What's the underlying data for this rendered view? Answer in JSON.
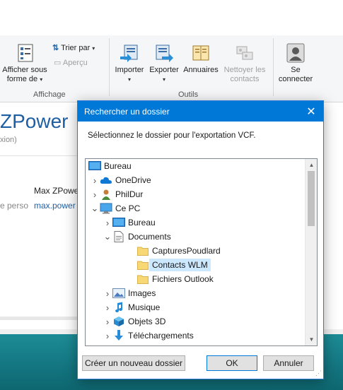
{
  "ribbon": {
    "affichage_group": "Affichage",
    "outils_group": "Outils",
    "afficher_sous_forme": "Afficher sous forme de",
    "afficher_line1": "Afficher sous",
    "afficher_line2": "forme de",
    "trier_par": "Trier par",
    "apercu": "Aperçu",
    "importer": "Importer",
    "exporter": "Exporter",
    "annuaires": "Annuaires",
    "nettoyer_line1": "Nettoyer les",
    "nettoyer_line2": "contacts",
    "se_line1": "Se",
    "se_line2": "connecter"
  },
  "background": {
    "title": "ZPower",
    "subtitle": "xion)",
    "contact_name": "Max ZPowe",
    "email_label": "e perso",
    "email_value": "max.power"
  },
  "dialog": {
    "title": "Rechercher un dossier",
    "message": "Sélectionnez le dossier pour l'exportation VCF.",
    "new_folder_button": "Créer un nouveau dossier",
    "ok_button": "OK",
    "cancel_button": "Annuler",
    "tree": [
      {
        "label": "Bureau",
        "icon": "desktop-icon",
        "arrow": "",
        "level": 0
      },
      {
        "label": "OneDrive",
        "icon": "onedrive-cloud-icon",
        "arrow": "›",
        "level": 1
      },
      {
        "label": "PhilDur",
        "icon": "user-icon",
        "arrow": "›",
        "level": 1
      },
      {
        "label": "Ce PC",
        "icon": "computer-icon",
        "arrow": "⌄",
        "level": 1
      },
      {
        "label": "Bureau",
        "icon": "desktop-icon",
        "arrow": "›",
        "level": 2
      },
      {
        "label": "Documents",
        "icon": "documents-icon",
        "arrow": "⌄",
        "level": 2
      },
      {
        "label": "CapturesPoudlard",
        "icon": "folder-icon",
        "arrow": "",
        "level": 3
      },
      {
        "label": "Contacts WLM",
        "icon": "folder-icon",
        "arrow": "",
        "level": 3,
        "selected": true
      },
      {
        "label": "Fichiers Outlook",
        "icon": "folder-icon",
        "arrow": "",
        "level": 3
      },
      {
        "label": "Images",
        "icon": "images-icon",
        "arrow": "›",
        "level": 2
      },
      {
        "label": "Musique",
        "icon": "music-icon",
        "arrow": "›",
        "level": 2
      },
      {
        "label": "Objets 3D",
        "icon": "objects3d-icon",
        "arrow": "›",
        "level": 2
      },
      {
        "label": "Téléchargements",
        "icon": "downloads-icon",
        "arrow": "›",
        "level": 2
      }
    ]
  },
  "colors": {
    "accent": "#0078d7",
    "selection": "#cce8ff",
    "folder": "#f8d775",
    "teal": "#137580"
  }
}
